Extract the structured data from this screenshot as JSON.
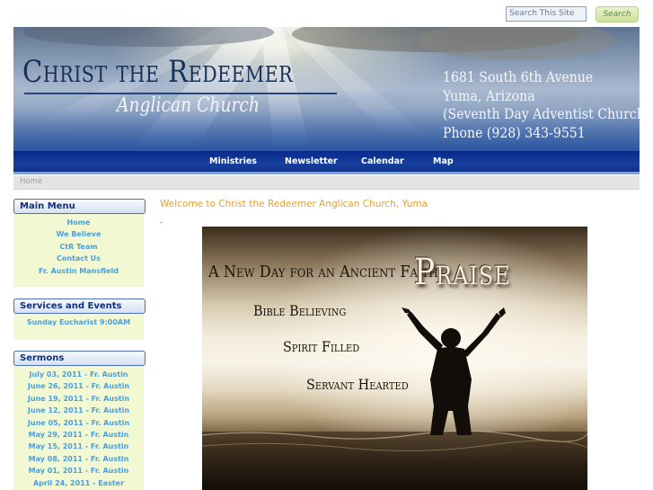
{
  "search": {
    "placeholder": "Search This Site",
    "button_label": "Search"
  },
  "header": {
    "title": "Christ the Redeemer",
    "subtitle": "Anglican Church",
    "address": [
      "1681 South 6th Avenue",
      "Yuma, Arizona",
      "(Seventh Day Adventist Church)",
      "Phone (928) 343-9551"
    ]
  },
  "nav": {
    "items": [
      "Ministries",
      "Newsletter",
      "Calendar",
      "Map"
    ]
  },
  "breadcrumb": {
    "home": "Home"
  },
  "sidebar": {
    "main_menu": {
      "title": "Main Menu",
      "items": [
        "Home",
        "We Believe",
        "CtR Team",
        "Contact Us",
        "Fr. Austin Mansfield"
      ]
    },
    "services": {
      "title": "Services and Events",
      "items": [
        "Sunday Eucharist 9:00AM"
      ]
    },
    "sermons": {
      "title": "Sermons",
      "items": [
        "July 03, 2011 - Fr. Austin",
        "June 26, 2011 - Fr. Austin",
        "June 19, 2011 - Fr. Austin",
        "June 12, 2011 - Fr. Austin",
        "June 05, 2011 - Fr. Austin",
        "May 29, 2011 - Fr. Austin",
        "May 15, 2011 - Fr. Austin",
        "May 08, 2011 - Fr. Austin",
        "May 01, 2011 - Fr. Austin",
        "April 24, 2011 - Easter"
      ]
    }
  },
  "main": {
    "welcome": "Welcome to Christ the Redeemer Anglican Church, Yuma",
    "dash": "-",
    "poster": {
      "line1": "A New Day for an Ancient Faith",
      "praise": "Praise",
      "line2": "Bible Believing",
      "line3": "Spirit Filled",
      "line4": "Servant Hearted"
    }
  },
  "colors": {
    "nav": "#17409e",
    "sidebar_bg": "#f2f9d2",
    "link": "#4a9ee0",
    "welcome": "#e0a23a",
    "box_border": "#4a6fb3"
  }
}
